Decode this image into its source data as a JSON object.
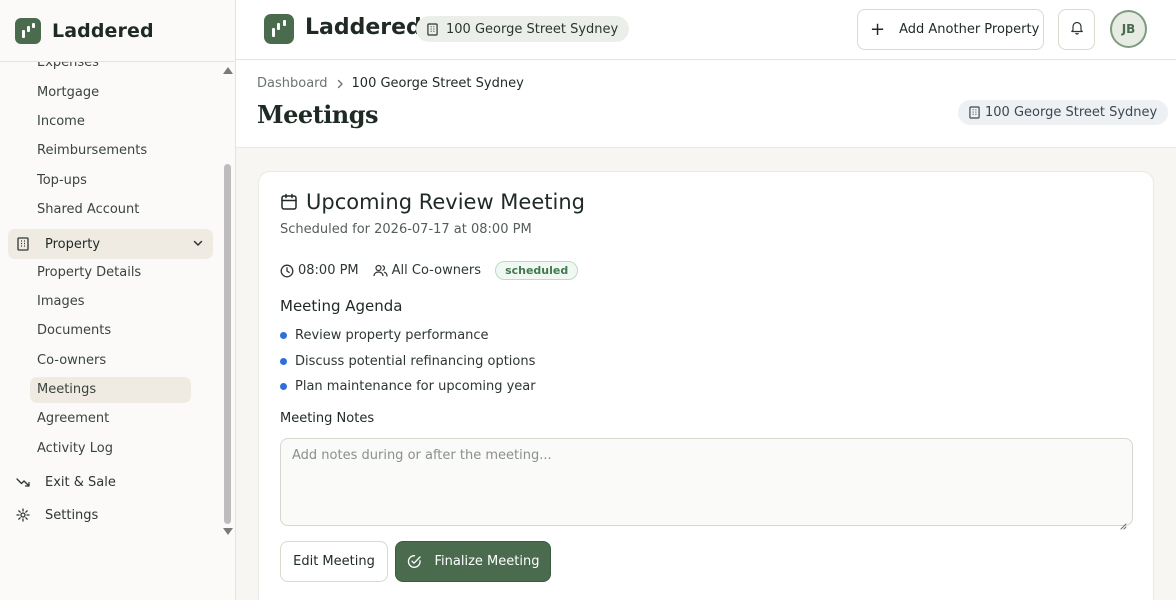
{
  "app": {
    "name": "Laddered"
  },
  "sidebar": {
    "items_top": [
      "Expenses",
      "Mortgage",
      "Income",
      "Reimbursements",
      "Top-ups",
      "Shared Account"
    ],
    "property_group": {
      "label": "Property",
      "icon": "building-icon"
    },
    "property_items": [
      "Property Details",
      "Images",
      "Documents",
      "Co-owners",
      "Meetings",
      "Agreement",
      "Activity Log"
    ],
    "active_item": "Meetings",
    "exit_sale": {
      "label": "Exit & Sale",
      "icon": "trending-down-icon"
    },
    "settings": {
      "label": "Settings",
      "icon": "gear-icon"
    }
  },
  "header": {
    "brand": "Laddered",
    "property_chip": "100 George Street Sydney",
    "add_button": "Add Another Property",
    "avatar_initials": "JB"
  },
  "page": {
    "breadcrumb": [
      "Dashboard",
      "100 George Street Sydney"
    ],
    "title": "Meetings",
    "property_chip": "100 George Street Sydney"
  },
  "meeting": {
    "title": "Upcoming Review Meeting",
    "scheduled": "Scheduled for 2026-07-17 at 08:00 PM",
    "time": "08:00 PM",
    "attendees": "All Co-owners",
    "status": "scheduled",
    "agenda_heading": "Meeting Agenda",
    "agenda": [
      "Review property performance",
      "Discuss potential refinancing options",
      "Plan maintenance for upcoming year"
    ],
    "notes_heading": "Meeting Notes",
    "notes_placeholder": "Add notes during or after the meeting...",
    "notes_value": "",
    "edit_button": "Edit Meeting",
    "finalize_button": "Finalize Meeting"
  },
  "colors": {
    "brand_green": "#4a6b4e",
    "bullet_blue": "#2f6fd9",
    "status_green": "#3f7a4d"
  }
}
